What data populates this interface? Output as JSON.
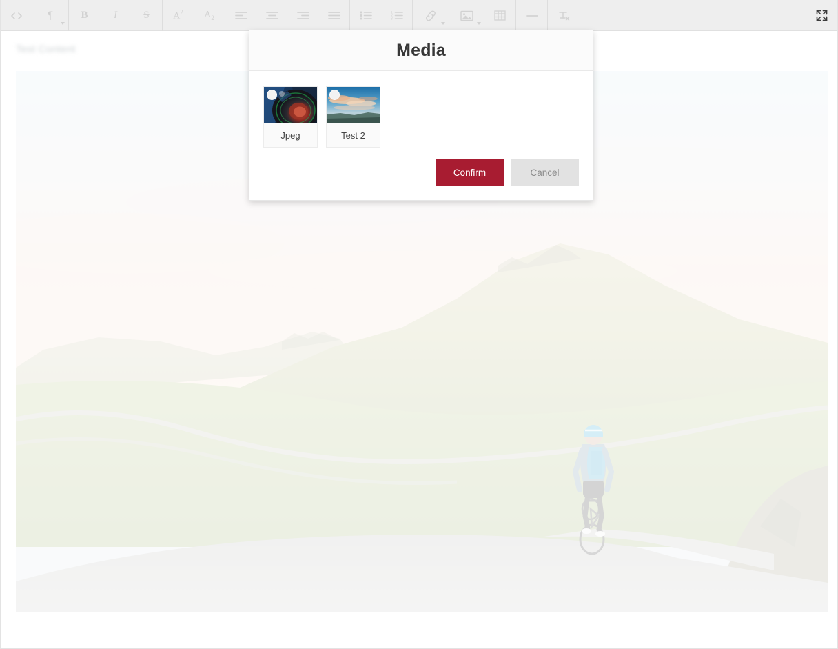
{
  "toolbar": {
    "groups": [
      {
        "name": "source",
        "buttons": [
          {
            "name": "code-view-icon",
            "label": "<>",
            "title": "Code View",
            "caret": false
          }
        ]
      },
      {
        "name": "paragraph",
        "buttons": [
          {
            "name": "paragraph-format-icon",
            "label": "¶",
            "title": "Paragraph Format",
            "caret": true
          }
        ]
      },
      {
        "name": "inline-style",
        "buttons": [
          {
            "name": "bold-icon",
            "label": "B",
            "title": "Bold",
            "caret": false
          },
          {
            "name": "italic-icon",
            "label": "I",
            "title": "Italic",
            "caret": false
          },
          {
            "name": "strikethrough-icon",
            "label": "S",
            "title": "Strikethrough",
            "caret": false
          }
        ]
      },
      {
        "name": "script",
        "buttons": [
          {
            "name": "superscript-icon",
            "label": "A2",
            "title": "Superscript",
            "caret": false
          },
          {
            "name": "subscript-icon",
            "label": "A2",
            "title": "Subscript",
            "caret": false
          }
        ]
      },
      {
        "name": "alignment",
        "buttons": [
          {
            "name": "align-left-icon",
            "label": "",
            "title": "Align Left",
            "caret": false
          },
          {
            "name": "align-center-icon",
            "label": "",
            "title": "Align Center",
            "caret": false
          },
          {
            "name": "align-right-icon",
            "label": "",
            "title": "Align Right",
            "caret": false
          },
          {
            "name": "align-justify-icon",
            "label": "",
            "title": "Justify",
            "caret": false
          }
        ]
      },
      {
        "name": "lists",
        "buttons": [
          {
            "name": "unordered-list-icon",
            "label": "",
            "title": "Unordered List",
            "caret": false
          },
          {
            "name": "ordered-list-icon",
            "label": "",
            "title": "Ordered List",
            "caret": false
          }
        ]
      },
      {
        "name": "insert",
        "buttons": [
          {
            "name": "link-icon",
            "label": "",
            "title": "Insert Link",
            "caret": true
          },
          {
            "name": "image-icon",
            "label": "",
            "title": "Insert Image",
            "caret": true
          },
          {
            "name": "table-icon",
            "label": "",
            "title": "Insert Table",
            "caret": false
          }
        ]
      },
      {
        "name": "misc",
        "buttons": [
          {
            "name": "horizontal-line-icon",
            "label": "—",
            "title": "Horizontal Line",
            "caret": false
          }
        ]
      },
      {
        "name": "clear",
        "buttons": [
          {
            "name": "clear-formatting-icon",
            "label": "Tx",
            "title": "Clear Formatting",
            "caret": false
          }
        ]
      }
    ],
    "fullscreen": {
      "name": "fullscreen-icon",
      "title": "Fullscreen"
    }
  },
  "editor": {
    "content_text": "Test Content",
    "hero_image_alt": "cyclist riding on mountain road at sunset"
  },
  "modal": {
    "title": "Media",
    "media_items": [
      {
        "label": "Jpeg",
        "thumb": "camera-lens-photo",
        "selected": false
      },
      {
        "label": "Test 2",
        "thumb": "sunset-sky-photo",
        "selected": false
      }
    ],
    "confirm_label": "Confirm",
    "cancel_label": "Cancel"
  },
  "colors": {
    "toolbar_bg": "#eeeeee",
    "toolbar_icon": "#d2d2d2",
    "confirm_bg": "#a81c31",
    "cancel_bg": "#e2e2e2",
    "modal_header_bg": "#fbfbfb",
    "title_color": "#373737"
  }
}
